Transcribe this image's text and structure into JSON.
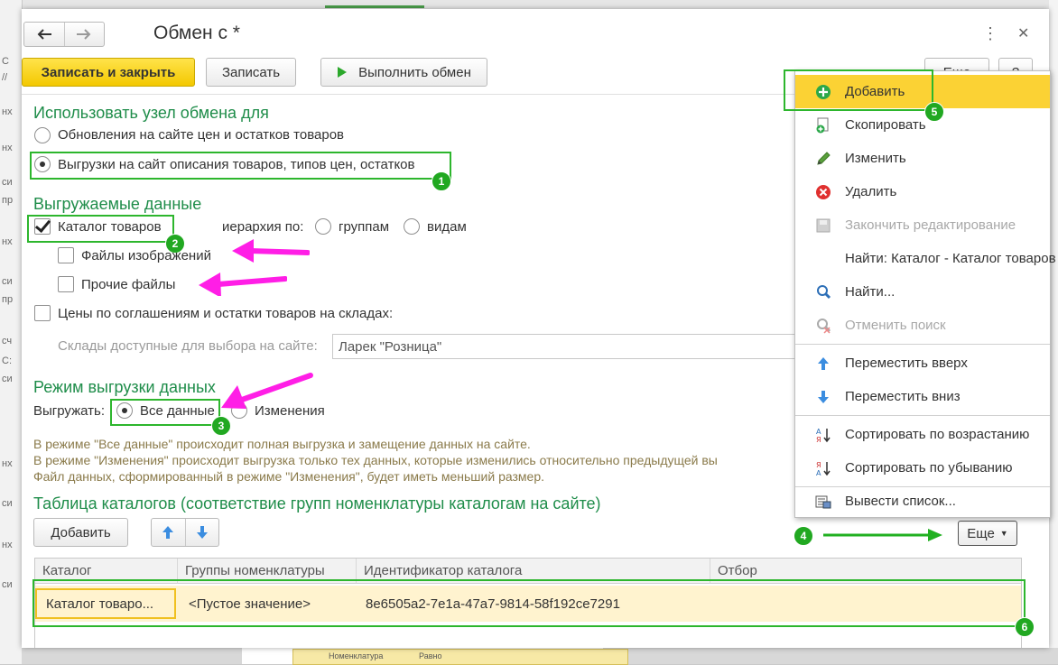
{
  "window": {
    "title": "Обмен с  *",
    "more_dots": "⋮",
    "close": "✕"
  },
  "toolbar": {
    "save_close": "Записать и закрыть",
    "save": "Записать",
    "run": "Выполнить обмен",
    "more": "Еще",
    "help": "?"
  },
  "node_section": {
    "title": "Использовать узел обмена для",
    "option1": "Обновления на сайте цен и остатков товаров",
    "option2": "Выгрузки на сайт описания товаров, типов цен, остатков"
  },
  "export_section": {
    "title": "Выгружаемые данные",
    "catalog": "Каталог товаров",
    "hierarchy_label": "иерархия по:",
    "hier_groups": "группам",
    "hier_kinds": "видам",
    "image_files": "Файлы изображений",
    "other_files": "Прочие файлы",
    "prices": "Цены по соглашениям и остатки товаров на складах:",
    "warehouses_label": "Склады доступные для выбора на сайте:",
    "warehouses_value": "Ларек \"Розница\""
  },
  "mode_section": {
    "title": "Режим выгрузки данных",
    "label": "Выгружать:",
    "all_data": "Все данные",
    "changes": "Изменения",
    "hint1": "В режиме \"Все данные\" происходит полная выгрузка  и замещение данных на сайте.",
    "hint2": "В режиме \"Изменения\" происходит выгрузка только тех данных, которые изменились относительно предыдущей вы",
    "hint3": "Файл данных, сформированный в режиме \"Изменения\", будет иметь меньший размер."
  },
  "table_section": {
    "title": "Таблица каталогов (соответствие групп номенклатуры каталогам на сайте)",
    "add": "Добавить",
    "more": "Еще",
    "columns": [
      "Каталог",
      "Группы номенклатуры",
      "Идентификатор каталога",
      "Отбор"
    ],
    "rows": [
      [
        "Каталог товаро...",
        "<Пустое значение>",
        "8e6505a2-7e1a-47a7-9814-58f192ce7291",
        ""
      ]
    ]
  },
  "menu": {
    "items": [
      {
        "label": "Добавить",
        "icon": "plus-circle-icon"
      },
      {
        "label": "Скопировать",
        "icon": "copy-icon"
      },
      {
        "label": "Изменить",
        "icon": "pencil-icon"
      },
      {
        "label": "Удалить",
        "icon": "delete-icon"
      },
      {
        "label": "Закончить редактирование",
        "icon": "end-edit-icon"
      },
      {
        "label": "Найти: Каталог - Каталог товаров",
        "icon": ""
      },
      {
        "label": "Найти...",
        "icon": "search-icon"
      },
      {
        "label": "Отменить поиск",
        "icon": "cancel-search-icon"
      },
      {
        "label": "Переместить вверх",
        "icon": "arrow-up-icon"
      },
      {
        "label": "Переместить вниз",
        "icon": "arrow-down-icon"
      },
      {
        "label": "Сортировать по возрастанию",
        "icon": "sort-asc-icon"
      },
      {
        "label": "Сортировать по убыванию",
        "icon": "sort-desc-icon"
      },
      {
        "label": "Вывести список...",
        "icon": "list-output-icon"
      }
    ]
  },
  "annotations": {
    "b1": "1",
    "b2": "2",
    "b3": "3",
    "b4": "4",
    "b5": "5",
    "b6": "6"
  },
  "background": {
    "left_fragments": [
      "С",
      "//",
      "нх",
      "нх",
      "си",
      "пр",
      "нх",
      "си",
      "пр",
      "сч",
      "С:",
      "си",
      "нх",
      "си",
      "нх",
      "си"
    ],
    "bottom_row_label": "Номенклатура",
    "bottom_row_value": "Равно"
  },
  "colors": {
    "accent_green": "#1f8d4a",
    "highlight_green": "#2db62d",
    "arrow_magenta": "#ff1ee6",
    "selected_yellow": "#fbd234",
    "row_yellow": "#fff3cf"
  }
}
